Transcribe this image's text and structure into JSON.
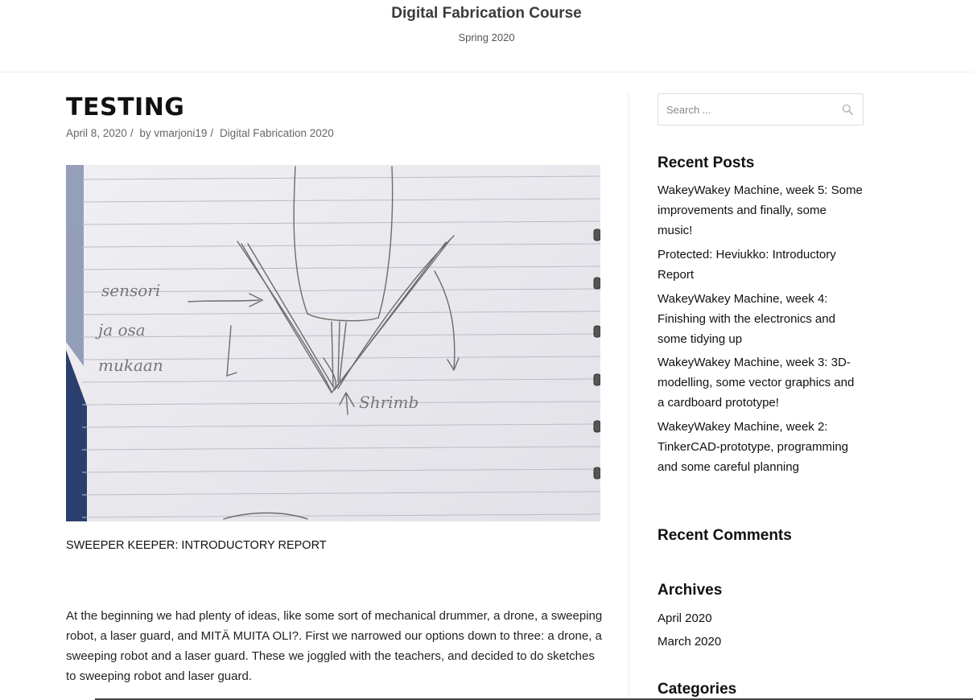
{
  "site": {
    "title": "Digital Fabrication Course",
    "description": "Spring 2020"
  },
  "post": {
    "title": "TESTING",
    "date": "April 8, 2020",
    "author_prefix": "by",
    "author": "vmarjoni19",
    "category": "Digital Fabrication 2020",
    "image": {
      "sketch_words": [
        "sensori",
        "ja osa",
        "mukaan",
        "Shrimb"
      ]
    },
    "heading": "SWEEPER KEEPER: INTRODUCTORY REPORT",
    "paragraph": "At the beginning we had plenty of ideas, like some sort of mechanical drummer, a drone, a sweeping robot, a laser guard, and MITÄ MUITA OLI?. First we narrowed our options down to three: a drone, a sweeping robot and a laser guard. These we joggled with the teachers, and decided to do sketches to sweeping robot and laser guard."
  },
  "sidebar": {
    "search_placeholder": "Search ...",
    "recent_posts_title": "Recent Posts",
    "recent_posts": [
      "WakeyWakey Machine, week 5: Some improvements and finally, some music!",
      "Protected: Heviukko: Introductory Report",
      "WakeyWakey Machine, week 4: Finishing with the electronics and some tidying up",
      "WakeyWakey Machine, week 3: 3D-modelling, some vector graphics and a cardboard prototype!",
      "WakeyWakey Machine, week 2: TinkerCAD-prototype, programming and some careful planning"
    ],
    "recent_comments_title": "Recent Comments",
    "archives_title": "Archives",
    "archives": [
      "April 2020",
      "March 2020"
    ],
    "categories_title": "Categories"
  }
}
